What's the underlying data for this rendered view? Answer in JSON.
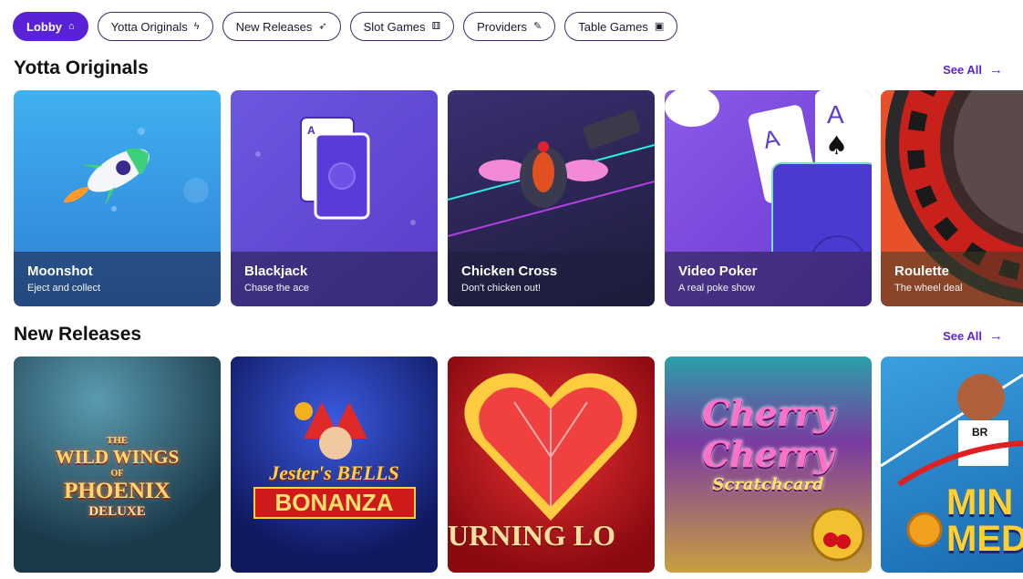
{
  "nav": {
    "tabs": [
      {
        "label": "Lobby",
        "icon": "home-icon",
        "glyph": "⌂",
        "active": true
      },
      {
        "label": "Yotta Originals",
        "icon": "lightning-icon",
        "glyph": "ϟ",
        "active": false
      },
      {
        "label": "New Releases",
        "icon": "rocket-icon",
        "glyph": "➶",
        "active": false
      },
      {
        "label": "Slot Games",
        "icon": "dice-icon",
        "glyph": "⚅",
        "active": false
      },
      {
        "label": "Providers",
        "icon": "pencil-icon",
        "glyph": "✎",
        "active": false
      },
      {
        "label": "Table Games",
        "icon": "card-icon",
        "glyph": "▣",
        "active": false
      }
    ]
  },
  "originals": {
    "title": "Yotta Originals",
    "see_all": "See All",
    "cards": [
      {
        "name": "Moonshot",
        "tagline": "Eject and collect",
        "bg": "#3aa5e8"
      },
      {
        "name": "Blackjack",
        "tagline": "Chase the ace",
        "bg": "#6a4fd8"
      },
      {
        "name": "Chicken Cross",
        "tagline": "Don't chicken out!",
        "bg": "#2a2550"
      },
      {
        "name": "Video Poker",
        "tagline": "A real poke show",
        "bg": "#7a48e0"
      },
      {
        "name": "Roulette",
        "tagline": "The wheel deal",
        "bg": "#e03a2a"
      }
    ]
  },
  "new_releases": {
    "title": "New Releases",
    "see_all": "See All",
    "games": [
      {
        "title_lines": [
          "THE",
          "WILD WINGS",
          "OF",
          "PHOENIX",
          "DELUXE"
        ],
        "bg": "#2a5a6a"
      },
      {
        "title_lines": [
          "Jester's BELLS",
          "BONANZA"
        ],
        "bg": "#1a2a7a"
      },
      {
        "title_lines": [
          "URNING LO"
        ],
        "bg": "#c8101a"
      },
      {
        "title_lines": [
          "Cherry",
          "Cherry",
          "Scratchcard"
        ],
        "bg": "#2a9aa0"
      },
      {
        "title_lines": [
          "BR",
          "MIN",
          "MED"
        ],
        "bg": "#2a8ac8"
      }
    ]
  }
}
